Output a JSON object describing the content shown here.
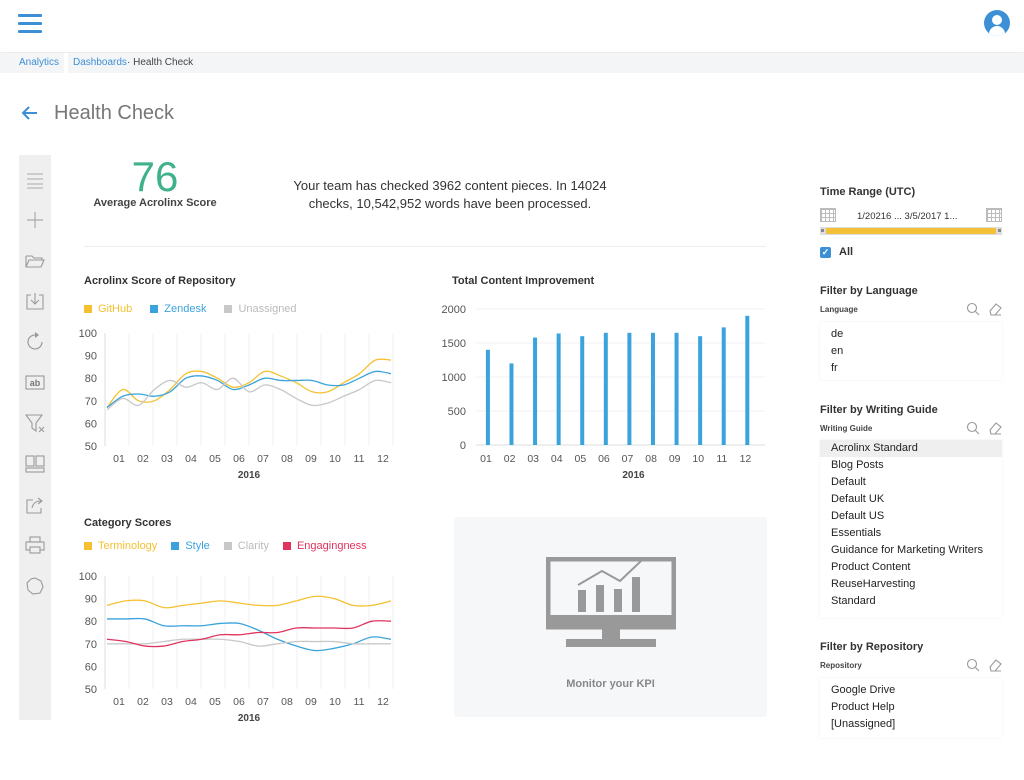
{
  "header": {
    "menu_icon": "hamburger-menu-icon",
    "user_icon": "user-account-icon"
  },
  "breadcrumb": {
    "items": [
      "Analytics",
      "Dashboards",
      "· Health Check"
    ]
  },
  "page": {
    "title": "Health Check",
    "back_icon": "back-arrow-icon"
  },
  "toolbar": {
    "icons": [
      "list-icon",
      "add-icon",
      "open-folder-icon",
      "import-icon",
      "refresh-icon",
      "text-field-icon",
      "clear-filter-icon",
      "layout-icon",
      "share-icon",
      "print-icon",
      "settings-icon"
    ]
  },
  "summary": {
    "score": "76",
    "score_label": "Average Acrolinx Score",
    "text": "Your team has checked 3962 content pieces. In 14024 checks, 10,542,952 words have been processed."
  },
  "kpi": {
    "label": "Monitor your KPI",
    "icon": "monitor-chart-icon"
  },
  "filters": {
    "time_range": {
      "title": "Time Range (UTC)",
      "value": "1/20216 ... 3/5/2017 1...",
      "all_label": "All",
      "all_checked": true,
      "range_fill": 1.0
    },
    "language": {
      "title": "Filter by Language",
      "label": "Language",
      "items": [
        "de",
        "en",
        "fr"
      ]
    },
    "writing_guide": {
      "title": "Filter by Writing Guide",
      "label": "Writing Guide",
      "items": [
        "Acrolinx Standard",
        "Blog Posts",
        "Default",
        "Default UK",
        "Default US",
        "Essentials",
        "Guidance for Marketing Writers",
        "Product Content",
        "ReuseHarvesting",
        "Standard"
      ],
      "selected": "Acrolinx Standard"
    },
    "repository": {
      "title": "Filter by Repository",
      "label": "Repository",
      "items": [
        "Google Drive",
        "Product Help",
        "[Unassigned]"
      ]
    }
  },
  "chart_data": [
    {
      "id": "repo",
      "type": "line",
      "title": "Acrolinx Score of Repository",
      "categories": [
        "01",
        "02",
        "03",
        "04",
        "05",
        "06",
        "07",
        "08",
        "09",
        "10",
        "11",
        "12"
      ],
      "xlabel": "2016",
      "ylabel": "",
      "ylim": [
        50,
        100
      ],
      "yticks": [
        50,
        60,
        70,
        80,
        90,
        100
      ],
      "grid": true,
      "legend": "top-left",
      "series": [
        {
          "name": "GitHub",
          "color": "#f5c132",
          "values": [
            67,
            75,
            70,
            70,
            75,
            82,
            83,
            80,
            76,
            78,
            83,
            81,
            78,
            74,
            74,
            78,
            82,
            88,
            88
          ]
        },
        {
          "name": "Zendesk",
          "color": "#3aa3dc",
          "values": [
            67,
            72,
            73,
            72,
            74,
            80,
            81,
            79,
            75,
            77,
            80,
            79,
            79,
            79,
            77,
            77,
            80,
            83,
            82
          ]
        },
        {
          "name": "Unassigned",
          "color": "#c8c8c8",
          "values": [
            66,
            71,
            68,
            75,
            79,
            76,
            78,
            75,
            80,
            74,
            77,
            75,
            71,
            68,
            69,
            72,
            75,
            79,
            78
          ]
        }
      ]
    },
    {
      "id": "content",
      "type": "bar",
      "title": "Total Content Improvement",
      "categories": [
        "01",
        "02",
        "03",
        "04",
        "05",
        "06",
        "07",
        "08",
        "09",
        "10",
        "11",
        "12"
      ],
      "values": [
        1400,
        1200,
        1580,
        1640,
        1600,
        1650,
        1650,
        1650,
        1650,
        1600,
        1730,
        1900
      ],
      "xlabel": "2016",
      "ylabel": "",
      "ylim": [
        0,
        2000
      ],
      "yticks": [
        0,
        500,
        1000,
        1500,
        2000
      ],
      "color": "#3aa3dc",
      "grid": true
    },
    {
      "id": "category",
      "type": "line",
      "title": "Category Scores",
      "categories": [
        "01",
        "02",
        "03",
        "04",
        "05",
        "06",
        "07",
        "08",
        "09",
        "10",
        "11",
        "12"
      ],
      "xlabel": "2016",
      "ylabel": "",
      "ylim": [
        50,
        100
      ],
      "yticks": [
        50,
        60,
        70,
        80,
        90,
        100
      ],
      "grid": true,
      "legend": "top-left",
      "series": [
        {
          "name": "Terminology",
          "color": "#f5c132",
          "values": [
            87,
            89,
            89,
            86,
            87,
            88,
            89,
            88,
            87,
            87,
            89,
            91,
            90,
            87,
            87,
            89
          ]
        },
        {
          "name": "Style",
          "color": "#3aa3dc",
          "values": [
            81,
            81,
            81,
            78,
            78,
            78,
            79,
            79,
            76,
            72,
            69,
            67,
            68,
            70,
            73,
            72
          ]
        },
        {
          "name": "Clarity",
          "color": "#c8c8c8",
          "values": [
            70,
            70,
            70,
            71,
            72,
            72,
            72,
            71,
            69,
            70,
            71,
            71,
            71,
            70,
            70,
            70
          ]
        },
        {
          "name": "Engagingness",
          "color": "#e0345e",
          "values": [
            72,
            71,
            69,
            69,
            71,
            72,
            74,
            74,
            75,
            75,
            77,
            77,
            77,
            77,
            80,
            80
          ]
        }
      ]
    }
  ]
}
